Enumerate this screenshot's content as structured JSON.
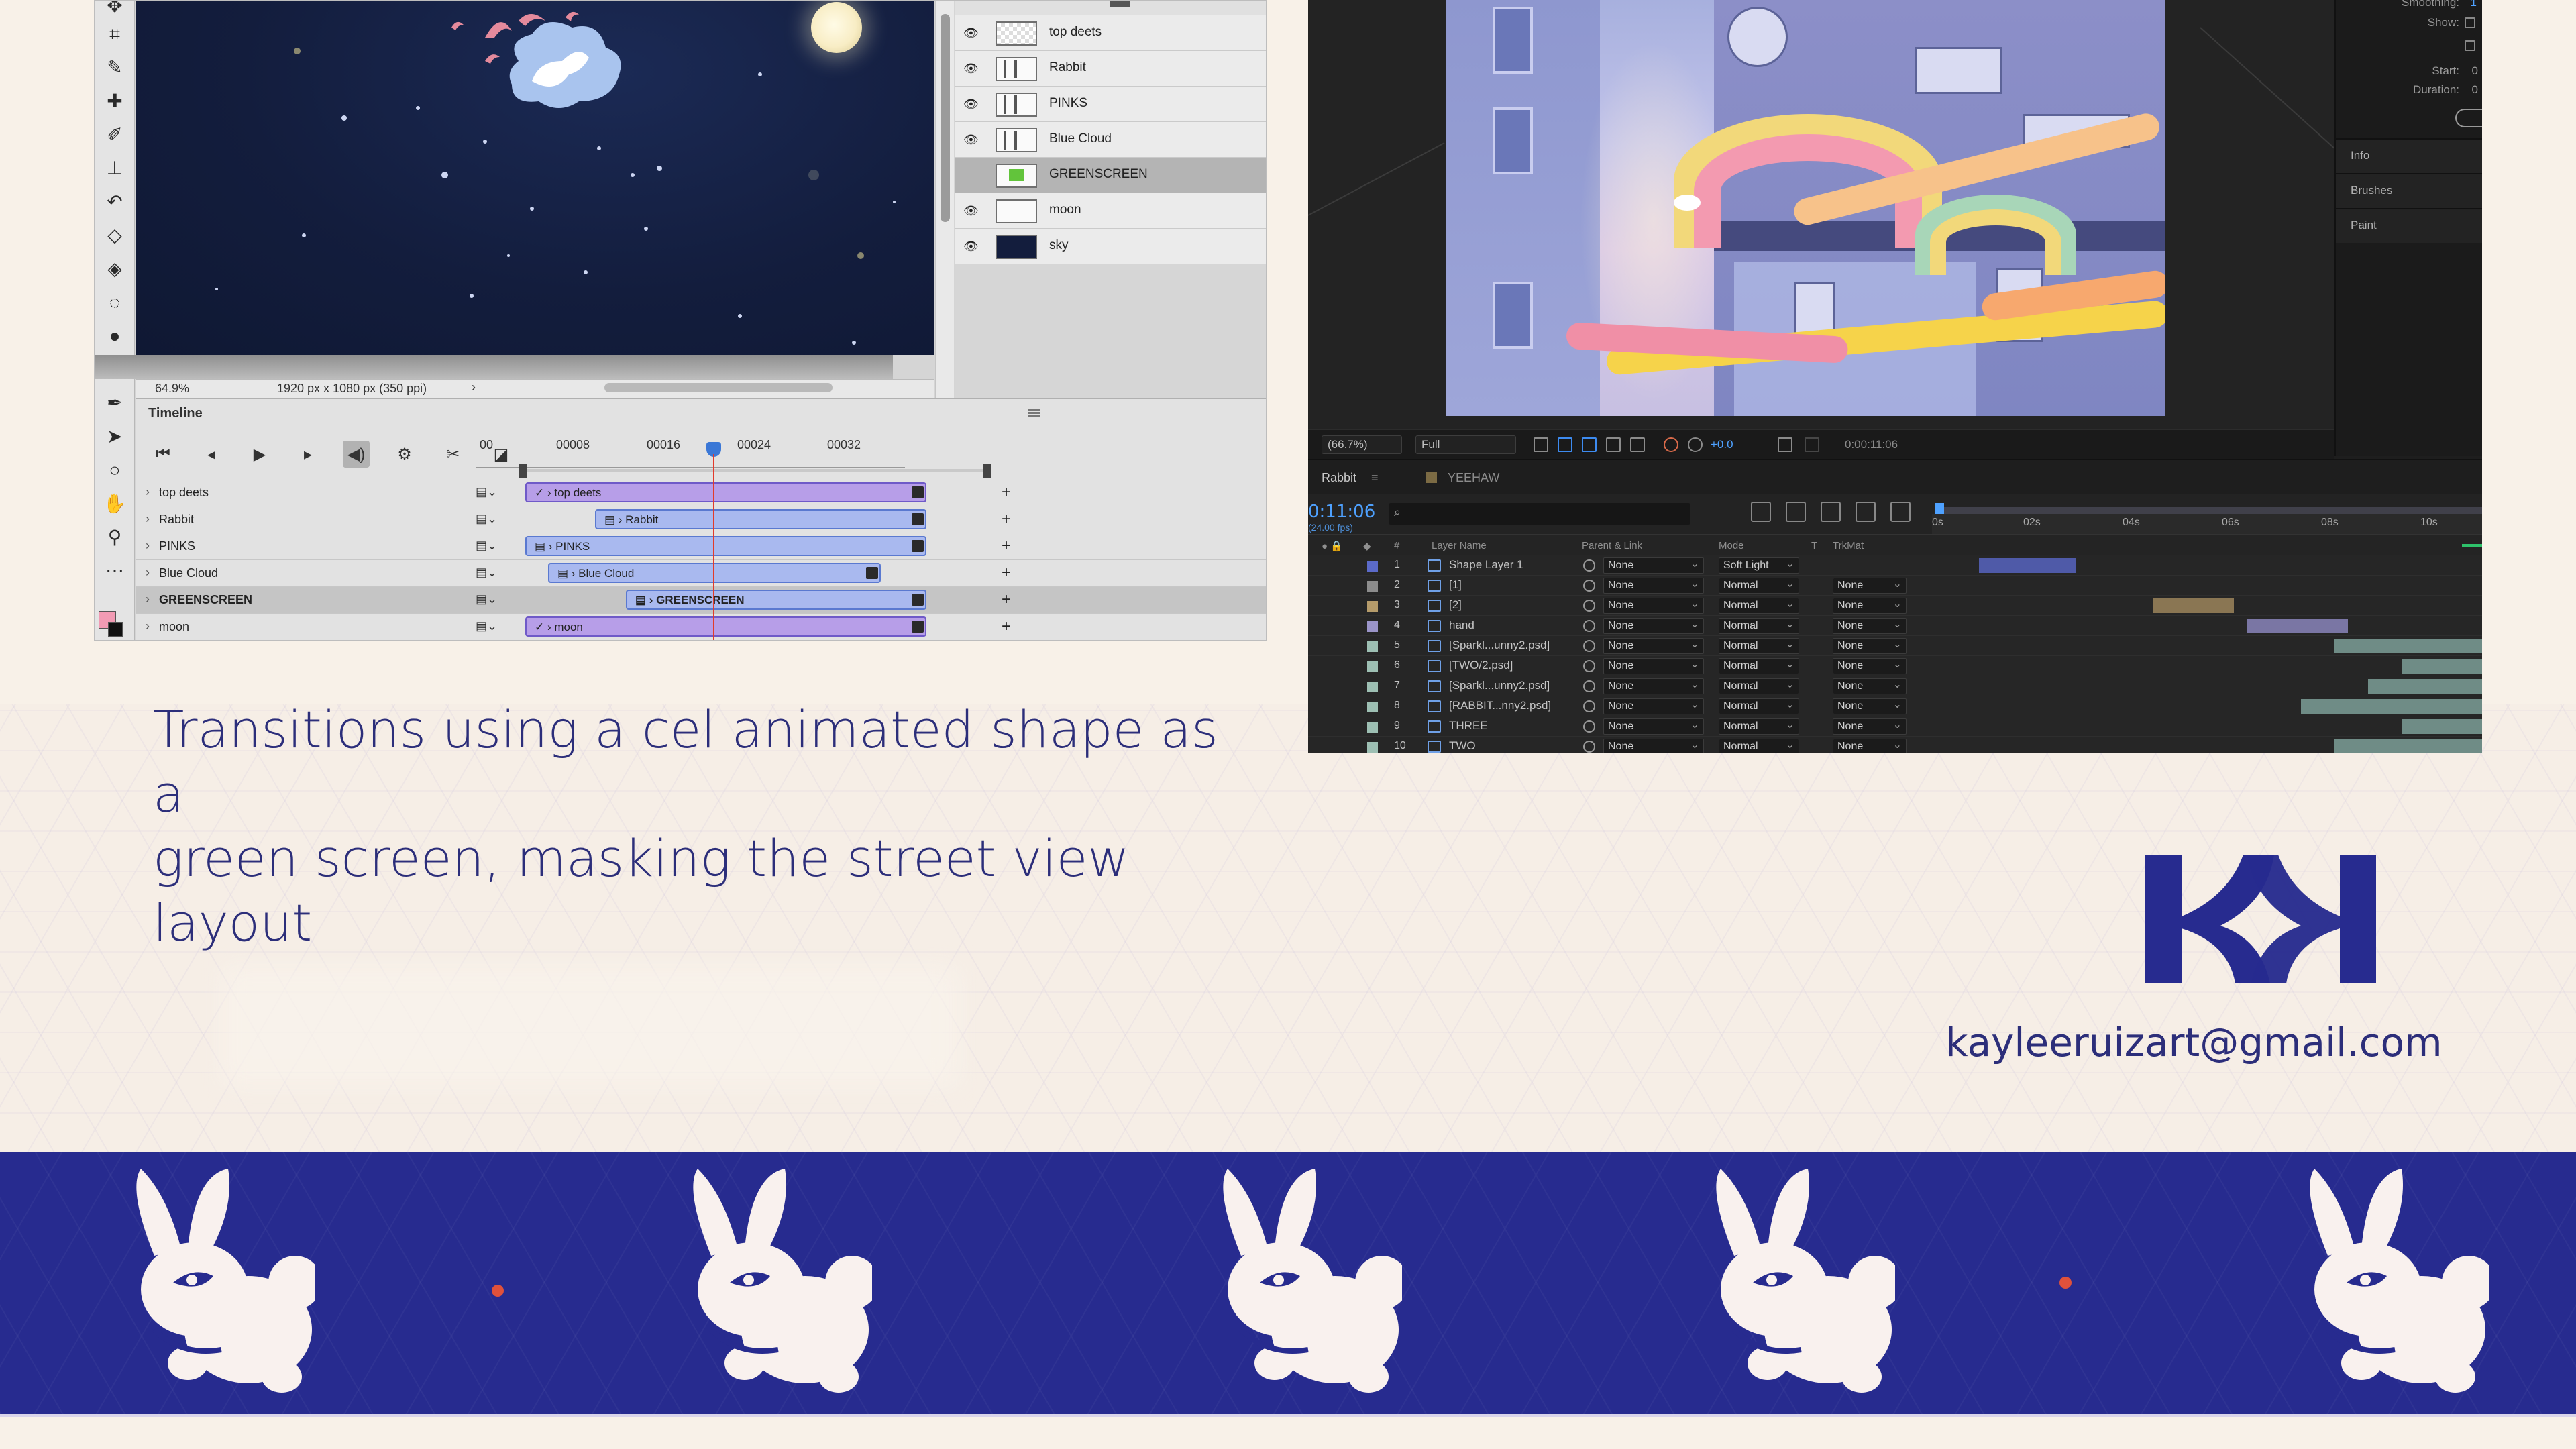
{
  "photoshop": {
    "zoom": "64.9%",
    "dimensions": "1920 px x 1080 px (350 ppi)",
    "status_arrow": "›",
    "timeline_title": "Timeline",
    "layers": [
      {
        "name": "top deets",
        "visible": true
      },
      {
        "name": "Rabbit",
        "visible": true
      },
      {
        "name": "PINKS",
        "visible": true
      },
      {
        "name": "Blue Cloud",
        "visible": true
      },
      {
        "name": "GREENSCREEN",
        "visible": false,
        "selected": true
      },
      {
        "name": "moon",
        "visible": true
      },
      {
        "name": "sky",
        "visible": true
      }
    ],
    "ruler": [
      "00",
      "00008",
      "00016",
      "00024",
      "00032"
    ],
    "tracks": [
      {
        "name": "top deets",
        "clip": "top deets"
      },
      {
        "name": "Rabbit",
        "clip": "Rabbit"
      },
      {
        "name": "PINKS",
        "clip": "PINKS"
      },
      {
        "name": "Blue Cloud",
        "clip": "Blue Cloud"
      },
      {
        "name": "GREENSCREEN",
        "clip": "GREENSCREEN"
      },
      {
        "name": "moon",
        "clip": "moon"
      }
    ],
    "controls": [
      "⏮",
      "◂",
      "▶",
      "▸",
      "◀)",
      "⚙",
      "✂",
      "◪"
    ]
  },
  "after_effects": {
    "viewer": {
      "zoom": "(66.7%)",
      "resolution": "Full",
      "exposure": "+0.0",
      "timecode": "0:00:11:06"
    },
    "right_panel": {
      "smoothing_label": "Smoothing:",
      "smoothing_value": "1",
      "show_label": "Show:",
      "start_label": "Start:",
      "start_value": "0",
      "duration_label": "Duration:",
      "duration_value": "0",
      "panels": [
        "Info",
        "Brushes",
        "Paint"
      ]
    },
    "tabs": [
      "Rabbit",
      "YEEHAW"
    ],
    "tab_menu": "≡",
    "timeline": {
      "time": "0:11:06",
      "fps": "(24.00 fps)",
      "search_icon": "⌕",
      "ruler": [
        "0s",
        "02s",
        "04s",
        "06s",
        "08s",
        "10s"
      ],
      "columns": [
        "#",
        "Layer Name",
        "Parent & Link",
        "Mode",
        "T",
        "TrkMat"
      ],
      "layers": [
        {
          "num": "1",
          "name": "Shape Layer 1",
          "parent": "None",
          "mode": "Soft Light",
          "trkmat": "",
          "color": "#5b6ac9"
        },
        {
          "num": "2",
          "name": "[1]",
          "parent": "None",
          "mode": "Normal",
          "trkmat": "None",
          "color": "#8c8c8c"
        },
        {
          "num": "3",
          "name": "[2]",
          "parent": "None",
          "mode": "Normal",
          "trkmat": "None",
          "color": "#b59b6a"
        },
        {
          "num": "4",
          "name": "hand",
          "parent": "None",
          "mode": "Normal",
          "trkmat": "None",
          "color": "#9a94c8"
        },
        {
          "num": "5",
          "name": "[Sparkl...unny2.psd]",
          "parent": "None",
          "mode": "Normal",
          "trkmat": "None",
          "color": "#9dbfb3"
        },
        {
          "num": "6",
          "name": "[TWO/2.psd]",
          "parent": "None",
          "mode": "Normal",
          "trkmat": "None",
          "color": "#9dbfb3"
        },
        {
          "num": "7",
          "name": "[Sparkl...unny2.psd]",
          "parent": "None",
          "mode": "Normal",
          "trkmat": "None",
          "color": "#9dbfb3"
        },
        {
          "num": "8",
          "name": "[RABBIT...nny2.psd]",
          "parent": "None",
          "mode": "Normal",
          "trkmat": "None",
          "color": "#9dbfb3"
        },
        {
          "num": "9",
          "name": "THREE",
          "parent": "None",
          "mode": "Normal",
          "trkmat": "None",
          "color": "#9dbfb3"
        },
        {
          "num": "10",
          "name": "TWO",
          "parent": "None",
          "mode": "Normal",
          "trkmat": "None",
          "color": "#9dbfb3"
        }
      ]
    }
  },
  "caption": {
    "line1": "Transitions using a cel animated shape as a",
    "line2": "green screen, masking the street view layout"
  },
  "brand": {
    "logo": "KR",
    "email": "kayleeruizart@gmail.com",
    "color": "#272b8f"
  }
}
